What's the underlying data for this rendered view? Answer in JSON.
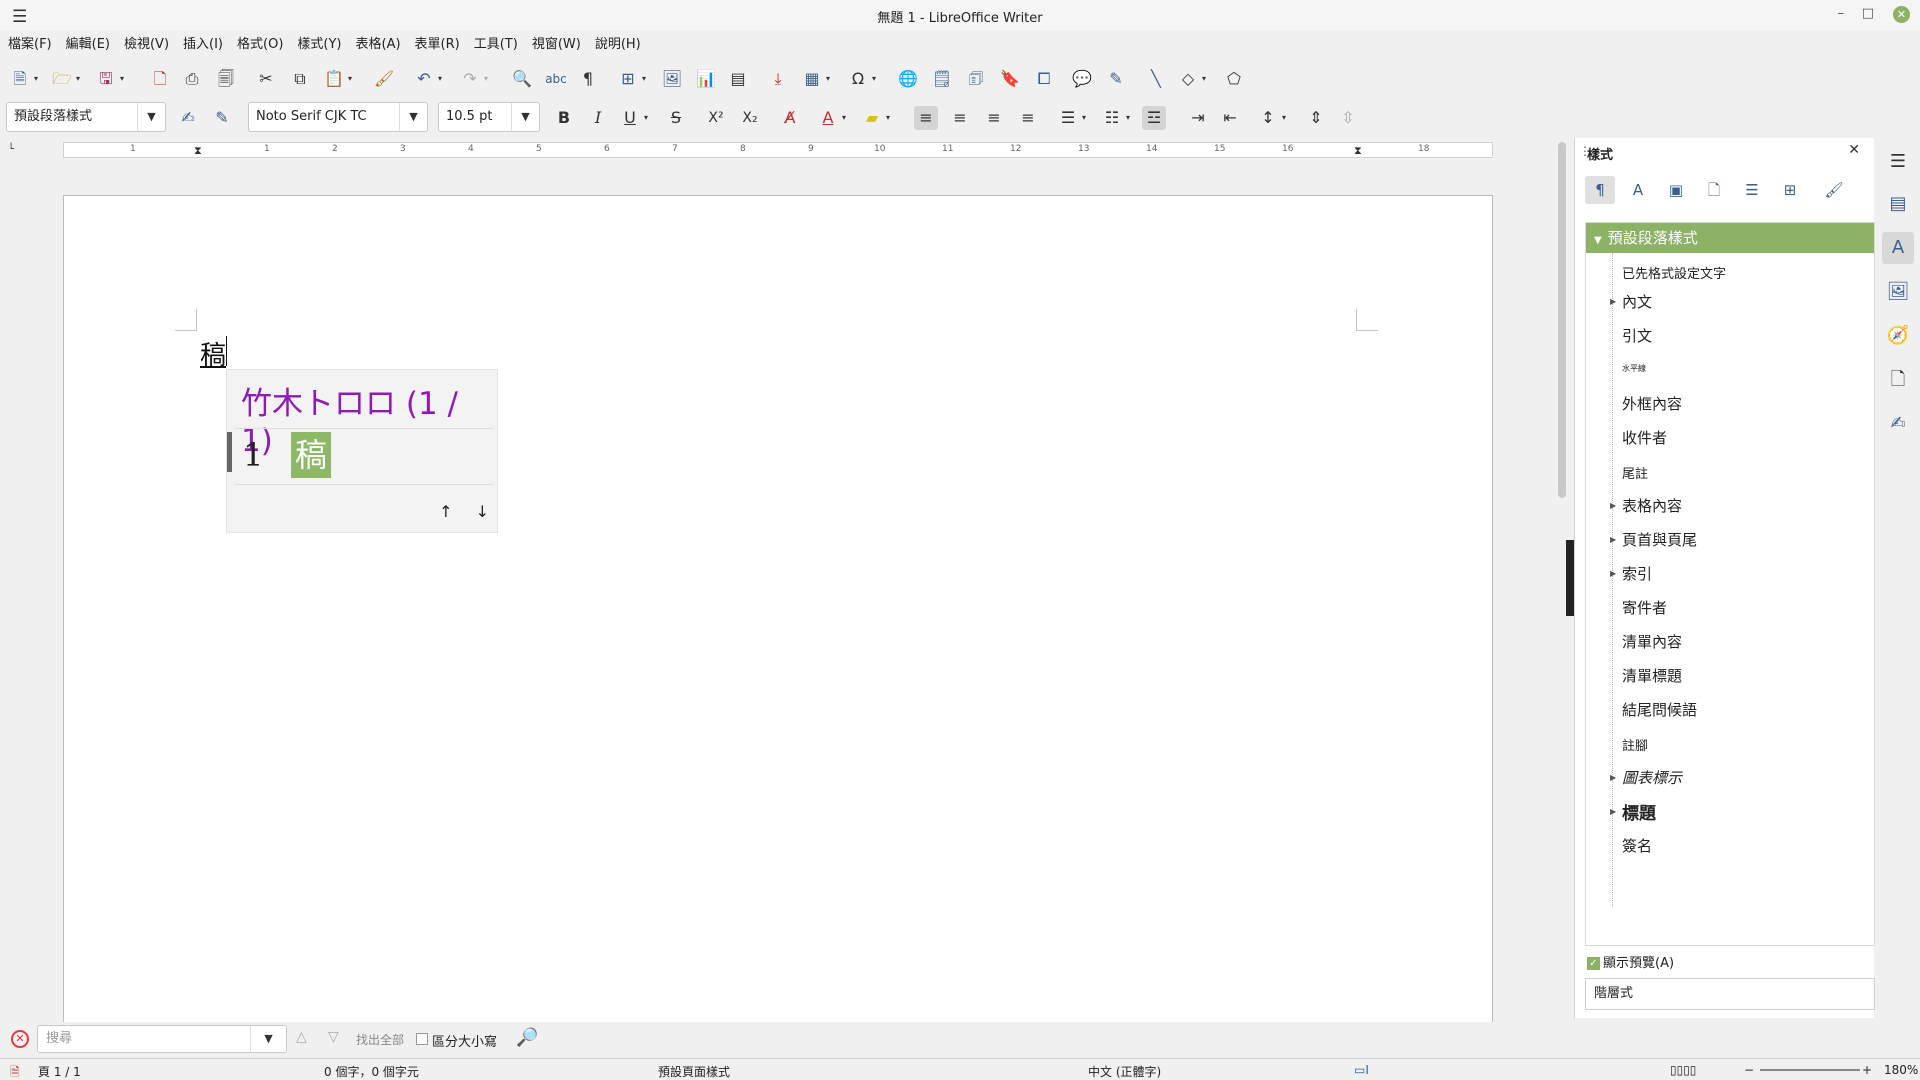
{
  "window": {
    "title": "無題 1 - LibreOffice Writer",
    "menu_icon": "☰",
    "minimize": "–",
    "maximize": "□",
    "close": "✕"
  },
  "menubar": {
    "items": [
      "檔案(F)",
      "編輯(E)",
      "檢視(V)",
      "插入(I)",
      "格式(O)",
      "樣式(Y)",
      "表格(A)",
      "表單(R)",
      "工具(T)",
      "視窗(W)",
      "說明(H)"
    ]
  },
  "toolbar2": {
    "paragraph_style": "預設段落樣式",
    "font_name": "Noto Serif CJK TC",
    "font_size": "10.5 pt"
  },
  "ruler": {
    "ticks": [
      "1",
      "1",
      "2",
      "3",
      "4",
      "5",
      "6",
      "7",
      "8",
      "9",
      "10",
      "11",
      "12",
      "13",
      "14",
      "15",
      "16",
      "18"
    ]
  },
  "document": {
    "text": "稿"
  },
  "ime": {
    "header": "竹木トロロ (1 / 1)",
    "candidate_number": "1",
    "candidate_char": "稿",
    "up": "↑",
    "down": "↓"
  },
  "findbar": {
    "search_placeholder": "搜尋",
    "find_all": "找出全部",
    "match_case": "區分大小寫"
  },
  "statusbar": {
    "page": "頁 1 / 1",
    "word_count": "0 個字，0 個字元",
    "page_style": "預設頁面樣式",
    "language": "中文 (正體字)",
    "zoom": "180%"
  },
  "sidebar": {
    "title": "樣式",
    "close": "✕",
    "root_style": "預設段落樣式",
    "styles": [
      {
        "label": "已先格式設定文字",
        "expandable": false,
        "size": "small"
      },
      {
        "label": "內文",
        "expandable": true,
        "size": "normal"
      },
      {
        "label": "引文",
        "expandable": false,
        "size": "normal"
      },
      {
        "label": "水平線",
        "expandable": false,
        "size": "tiny"
      },
      {
        "label": "外框內容",
        "expandable": false,
        "size": "normal"
      },
      {
        "label": "收件者",
        "expandable": false,
        "size": "normal"
      },
      {
        "label": "尾註",
        "expandable": false,
        "size": "small"
      },
      {
        "label": "表格內容",
        "expandable": true,
        "size": "normal"
      },
      {
        "label": "頁首與頁尾",
        "expandable": true,
        "size": "normal"
      },
      {
        "label": "索引",
        "expandable": true,
        "size": "normal"
      },
      {
        "label": "寄件者",
        "expandable": false,
        "size": "normal"
      },
      {
        "label": "清單內容",
        "expandable": false,
        "size": "normal"
      },
      {
        "label": "清單標題",
        "expandable": false,
        "size": "normal"
      },
      {
        "label": "結尾問候語",
        "expandable": false,
        "size": "normal"
      },
      {
        "label": "註腳",
        "expandable": false,
        "size": "small"
      },
      {
        "label": "圖表標示",
        "expandable": true,
        "size": "italic"
      },
      {
        "label": "標題",
        "expandable": true,
        "size": "bold"
      },
      {
        "label": "簽名",
        "expandable": false,
        "size": "normal"
      }
    ],
    "show_preview": "顯示預覽(A)",
    "filter": "階層式"
  },
  "colors": {
    "accent_green": "#8cb266",
    "ime_purple": "#8f1ab5",
    "icon_blue": "#3a5f8f"
  }
}
